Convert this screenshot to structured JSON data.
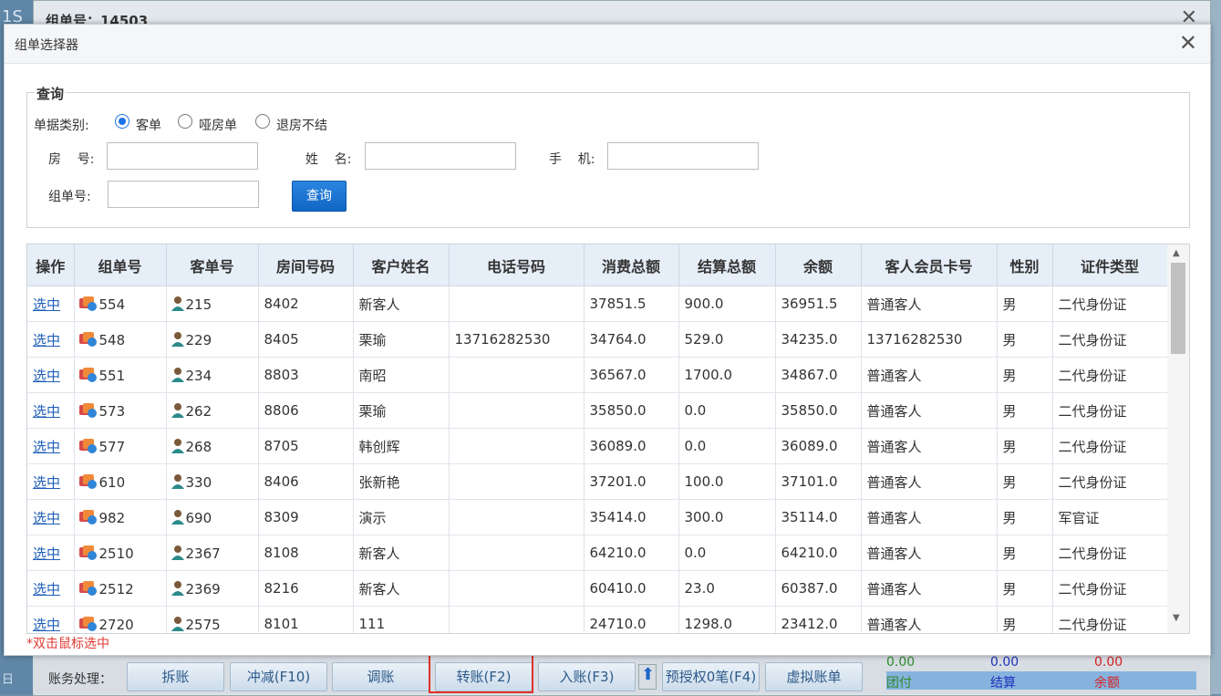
{
  "background": {
    "window_title": "组单号：14503",
    "left_text": "1S",
    "left_bottom_text": "日",
    "account_bar": {
      "label": "账务处理：",
      "buttons": [
        "拆账",
        "冲减(F10)",
        "调账",
        "转账(F2)",
        "入账(F3)",
        "预授权0笔(F4)",
        "虚拟账单"
      ]
    },
    "summary": {
      "values": [
        "0.00",
        "0.00",
        "0.00"
      ],
      "labels": [
        "团付",
        "结算",
        "余额"
      ],
      "colors": [
        "#2e8b2e",
        "#2233bb",
        "#d62222"
      ]
    }
  },
  "dialog": {
    "title": "组单选择器",
    "query": {
      "legend": "查询",
      "type_label": "单据类别:",
      "radio_options": [
        "客单",
        "哑房单",
        "退房不结"
      ],
      "selected_option": "客单",
      "room_label": "房    号:",
      "name_label": "姓    名:",
      "phone_label": "手    机:",
      "group_label": "组单号:",
      "room_value": "",
      "name_value": "",
      "phone_value": "",
      "group_value": "",
      "query_button": "查询"
    },
    "table": {
      "columns": [
        "操作",
        "组单号",
        "客单号",
        "房间号码",
        "客户姓名",
        "电话号码",
        "消费总额",
        "结算总额",
        "余额",
        "客人会员卡号",
        "性别",
        "证件类型"
      ],
      "rows": [
        [
          "选中",
          "554",
          "215",
          "8402",
          "新客人",
          "",
          "37851.5",
          "900.0",
          "36951.5",
          "普通客人",
          "男",
          "二代身份证"
        ],
        [
          "选中",
          "548",
          "229",
          "8405",
          "栗瑜",
          "13716282530",
          "34764.0",
          "529.0",
          "34235.0",
          "13716282530",
          "男",
          "二代身份证"
        ],
        [
          "选中",
          "551",
          "234",
          "8803",
          "南昭",
          "",
          "36567.0",
          "1700.0",
          "34867.0",
          "普通客人",
          "男",
          "二代身份证"
        ],
        [
          "选中",
          "573",
          "262",
          "8806",
          "栗瑜",
          "",
          "35850.0",
          "0.0",
          "35850.0",
          "普通客人",
          "男",
          "二代身份证"
        ],
        [
          "选中",
          "577",
          "268",
          "8705",
          "韩创辉",
          "",
          "36089.0",
          "0.0",
          "36089.0",
          "普通客人",
          "男",
          "二代身份证"
        ],
        [
          "选中",
          "610",
          "330",
          "8406",
          "张新艳",
          "",
          "37201.0",
          "100.0",
          "37101.0",
          "普通客人",
          "男",
          "二代身份证"
        ],
        [
          "选中",
          "982",
          "690",
          "8309",
          "演示",
          "",
          "35414.0",
          "300.0",
          "35114.0",
          "普通客人",
          "男",
          "军官证"
        ],
        [
          "选中",
          "2510",
          "2367",
          "8108",
          "新客人",
          "",
          "64210.0",
          "0.0",
          "64210.0",
          "普通客人",
          "男",
          "二代身份证"
        ],
        [
          "选中",
          "2512",
          "2369",
          "8216",
          "新客人",
          "",
          "60410.0",
          "23.0",
          "60387.0",
          "普通客人",
          "男",
          "二代身份证"
        ],
        [
          "选中",
          "2720",
          "2575",
          "8101",
          "111",
          "",
          "24710.0",
          "1298.0",
          "23412.0",
          "普通客人",
          "男",
          "二代身份证"
        ]
      ]
    },
    "hint": "*双击鼠标选中"
  }
}
